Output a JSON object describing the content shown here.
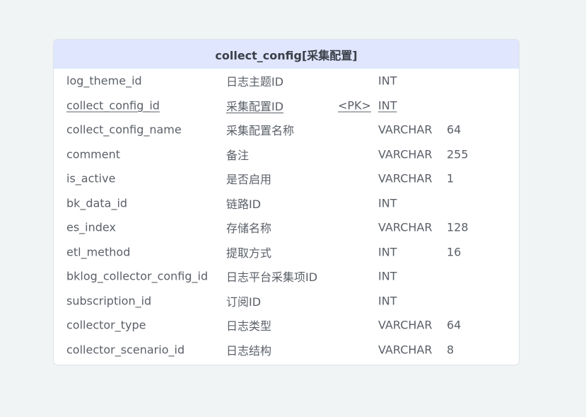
{
  "entity": {
    "title": "collect_config[采集配置]",
    "header_color": "#dfe6fe",
    "fields": [
      {
        "name": "log_theme_id",
        "comment": "日志主题ID",
        "key": "",
        "type": "INT",
        "length": ""
      },
      {
        "name": "collect_config_id",
        "comment": "采集配置ID",
        "key": "<PK>",
        "type": "INT",
        "length": ""
      },
      {
        "name": "collect_config_name",
        "comment": "采集配置名称",
        "key": "",
        "type": "VARCHAR",
        "length": "64"
      },
      {
        "name": "comment",
        "comment": "备注",
        "key": "",
        "type": "VARCHAR",
        "length": "255"
      },
      {
        "name": "is_active",
        "comment": "是否启用",
        "key": "",
        "type": "VARCHAR",
        "length": "1"
      },
      {
        "name": "bk_data_id",
        "comment": "链路ID",
        "key": "",
        "type": "INT",
        "length": ""
      },
      {
        "name": "es_index",
        "comment": "存储名称",
        "key": "",
        "type": "VARCHAR",
        "length": "128"
      },
      {
        "name": "etl_method",
        "comment": "提取方式",
        "key": "",
        "type": "INT",
        "length": "16"
      },
      {
        "name": "bklog_collector_config_id",
        "comment": "日志平台采集项ID",
        "key": "",
        "type": "INT",
        "length": ""
      },
      {
        "name": "subscription_id",
        "comment": "订阅ID",
        "key": "",
        "type": "INT",
        "length": ""
      },
      {
        "name": "collector_type",
        "comment": "日志类型",
        "key": "",
        "type": "VARCHAR",
        "length": "64"
      },
      {
        "name": "collector_scenario_id",
        "comment": "日志结构",
        "key": "",
        "type": "VARCHAR",
        "length": "8"
      }
    ]
  }
}
